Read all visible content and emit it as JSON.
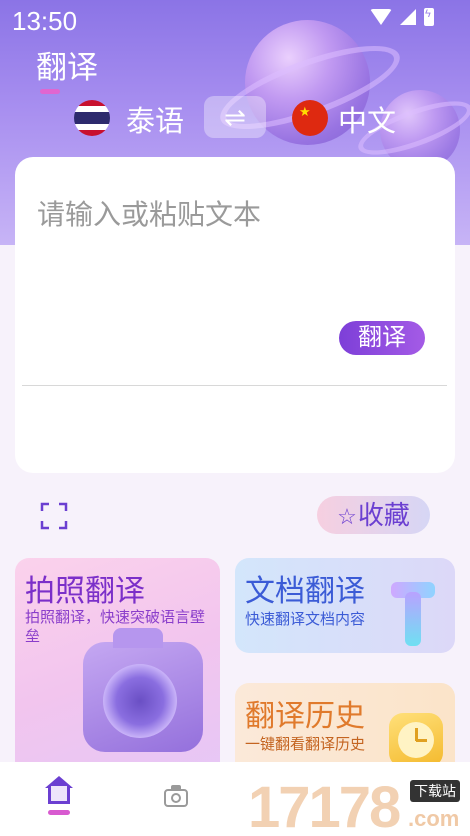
{
  "status_bar": {
    "time": "13:50"
  },
  "header": {
    "title": "翻译"
  },
  "languages": {
    "source": "泰语",
    "target": "中文",
    "swap_icon": "⇌"
  },
  "input": {
    "placeholder": "请输入或粘贴文本",
    "translate_button": "翻译"
  },
  "actions": {
    "favorite_label": "收藏",
    "favorite_icon": "☆"
  },
  "features": {
    "photo": {
      "title": "拍照翻译",
      "subtitle": "拍照翻译，快速突破语言壁垒"
    },
    "document": {
      "title": "文档翻译",
      "subtitle": "快速翻译文档内容"
    },
    "history": {
      "title": "翻译历史",
      "subtitle": "一键翻看翻译历史"
    }
  },
  "watermark": {
    "number": "17178",
    "tag": "下载站",
    "domain": ".com"
  },
  "colors": {
    "accent": "#7d3fd8",
    "header_bg": "#8b74e6",
    "card_bg": "#ffffff"
  }
}
